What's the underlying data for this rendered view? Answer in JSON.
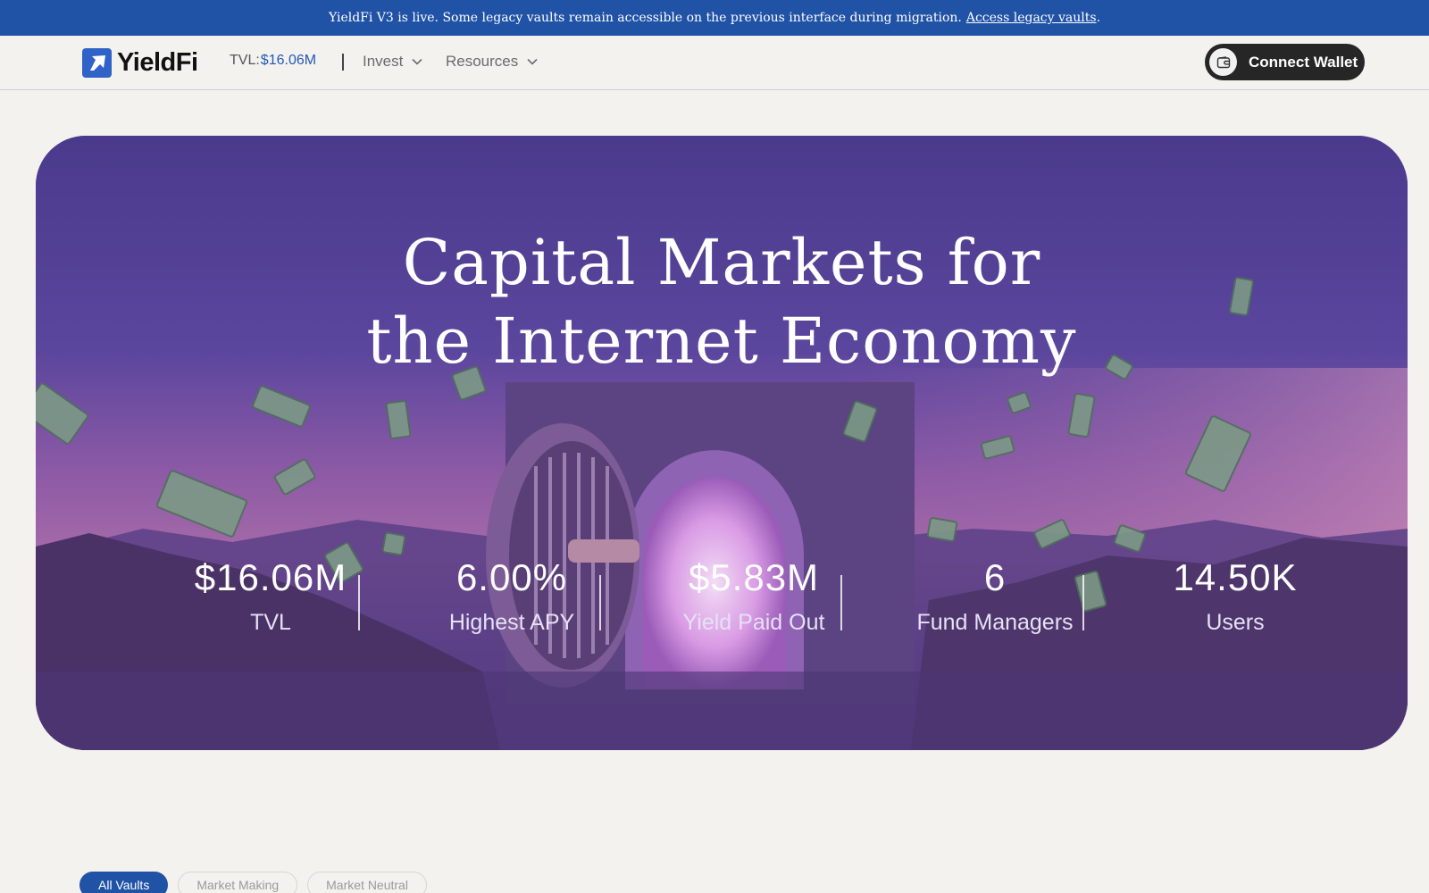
{
  "announcement": {
    "text": "YieldFi V3 is live. Some legacy vaults remain accessible on the previous interface during migration.",
    "link_label": "Access legacy vaults",
    "trailing": "."
  },
  "header": {
    "brand": "YieldFi",
    "tvl_label": "TVL:",
    "tvl_value": "$16.06M",
    "nav": [
      {
        "label": "Invest",
        "icon": "chevron-down-icon"
      },
      {
        "label": "Resources",
        "icon": "chevron-down-icon"
      }
    ],
    "connect_label": "Connect Wallet",
    "connect_icon": "wallet-icon"
  },
  "hero": {
    "title_line1": "Capital Markets for",
    "title_line2": "the Internet Economy",
    "stats": [
      {
        "value": "$16.06M",
        "label": "TVL"
      },
      {
        "value": "6.00%",
        "label": "Highest APY"
      },
      {
        "value": "$5.83M",
        "label": "Yield Paid Out"
      },
      {
        "value": "6",
        "label": "Fund Managers"
      },
      {
        "value": "14.50K",
        "label": "Users"
      }
    ]
  },
  "filters": {
    "tabs": [
      {
        "label": "All Vaults",
        "active": true
      },
      {
        "label": "Market Making",
        "active": false
      },
      {
        "label": "Market Neutral",
        "active": false
      }
    ]
  },
  "colors": {
    "brand_blue": "#2052a6",
    "accent_blue": "#2459b8",
    "page_bg": "#f3f2ee",
    "button_dark": "#262626",
    "hero_purple": "#5a449c"
  }
}
